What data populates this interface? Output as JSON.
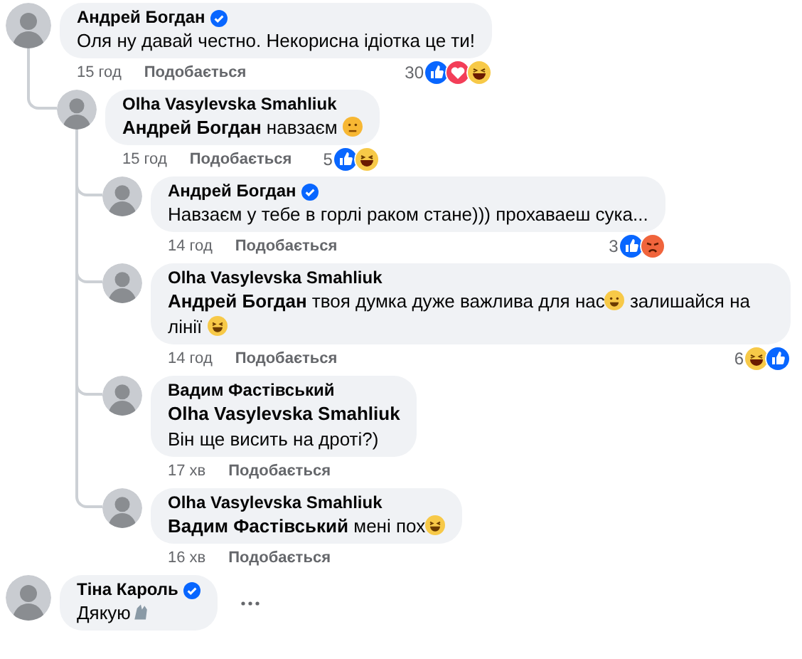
{
  "comments": [
    {
      "author": "Андрей Богдан",
      "verified": true,
      "body": [
        {
          "kind": "text",
          "text": "Оля ну давай честно. Некорисна ідіотка це ти!"
        }
      ],
      "time": "15 год",
      "like": "Подобається",
      "reactions": {
        "count": "30",
        "icons": [
          {
            "kind": "like"
          },
          {
            "kind": "love"
          },
          {
            "kind": "haha"
          }
        ]
      },
      "children": [
        {
          "author": "Olha Vasylevska Smahliuk",
          "verified": false,
          "body": [
            {
              "kind": "mention",
              "text": "Андрей Богдан"
            },
            {
              "kind": "text",
              "text": " навзаєм "
            },
            {
              "kind": "huff"
            }
          ],
          "time": "15 год",
          "like": "Подобається",
          "reactions": {
            "count": "5",
            "icons": [
              {
                "kind": "like"
              },
              {
                "kind": "haha"
              }
            ]
          },
          "children": [
            {
              "author": "Андрей Богдан",
              "verified": true,
              "body": [
                {
                  "kind": "text",
                  "text": "Навзаєм у тебе в горлі раком стане))) прохаваеш сука..."
                }
              ],
              "time": "14 год",
              "like": "Подобається",
              "reactions": {
                "count": "3",
                "icons": [
                  {
                    "kind": "like"
                  },
                  {
                    "kind": "angry"
                  }
                ]
              }
            },
            {
              "author": "Olha Vasylevska Smahliuk",
              "verified": false,
              "body": [
                {
                  "kind": "mention",
                  "text": "Андрей Богдан"
                },
                {
                  "kind": "text",
                  "text": " твоя думка дуже важлива для нас"
                },
                {
                  "kind": "grin"
                },
                {
                  "kind": "text",
                  "text": " залишайся на лінії "
                },
                {
                  "kind": "laugh"
                }
              ],
              "time": "14 год",
              "like": "Подобається",
              "reactions": {
                "count": "6",
                "icons": [
                  {
                    "kind": "haha"
                  },
                  {
                    "kind": "like"
                  }
                ]
              }
            },
            {
              "author": "Вадим Фастівський",
              "verified": false,
              "body": [
                {
                  "kind": "mention",
                  "text": "Olha Vasylevska Smahliuk"
                },
                {
                  "kind": "break"
                },
                {
                  "kind": "text",
                  "text": "Він ще висить на дроті?)"
                }
              ],
              "time": "17 хв",
              "like": "Подобається"
            },
            {
              "author": "Olha Vasylevska Smahliuk",
              "verified": false,
              "body": [
                {
                  "kind": "mention",
                  "text": "Вадим Фастівський"
                },
                {
                  "kind": "text",
                  "text": " мені пох"
                },
                {
                  "kind": "rofl"
                }
              ],
              "time": "16 хв",
              "like": "Подобається"
            }
          ]
        }
      ]
    },
    {
      "author": "Тіна Кароль",
      "verified": true,
      "body": [
        {
          "kind": "text",
          "text": "Дякую"
        },
        {
          "kind": "hands"
        }
      ],
      "more": true
    }
  ]
}
